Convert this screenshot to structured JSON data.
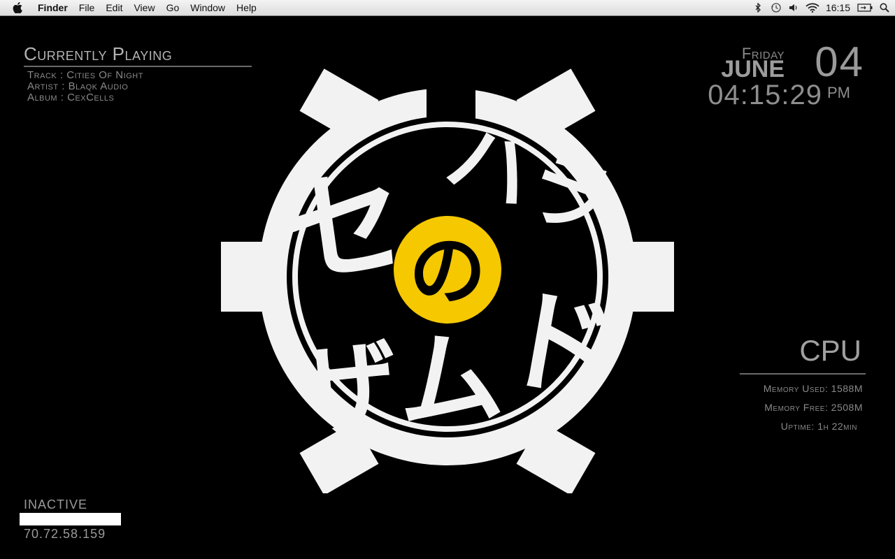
{
  "menubar": {
    "app_name": "Finder",
    "menus": [
      "File",
      "Edit",
      "View",
      "Go",
      "Window",
      "Help"
    ],
    "clock": "16:15",
    "icons": [
      "apple-icon",
      "bluetooth-icon",
      "time-machine-icon",
      "volume-icon",
      "wifi-icon",
      "battery-icon",
      "spotlight-search-icon"
    ]
  },
  "now_playing": {
    "title": "Currently Playing",
    "lines": [
      {
        "label": "Track",
        "value": "Cities Of Night"
      },
      {
        "label": "Artist",
        "value": "Blaqk Audio"
      },
      {
        "label": "Album",
        "value": "CexCells"
      }
    ]
  },
  "datetime": {
    "day": "Friday",
    "month": "JUNE",
    "date": "04",
    "time": "04:15:29",
    "ampm": "PM"
  },
  "system": {
    "title": "CPU",
    "memory_used": "Memory Used: 1588M",
    "memory_free": "Memory Free: 2508M",
    "uptime": "Uptime: 1h 22min"
  },
  "network": {
    "status": "INACTIVE",
    "ip": "70.72.58.159"
  },
  "wallpaper": {
    "logo_text_left": "セ",
    "logo_text_bottom": "ザム",
    "logo_text_right": "ハラ",
    "logo_text_right2": "ド",
    "logo_center": "の",
    "colors": {
      "gear": "#f2f2f2",
      "accent": "#f5c800",
      "background": "#000000"
    }
  }
}
